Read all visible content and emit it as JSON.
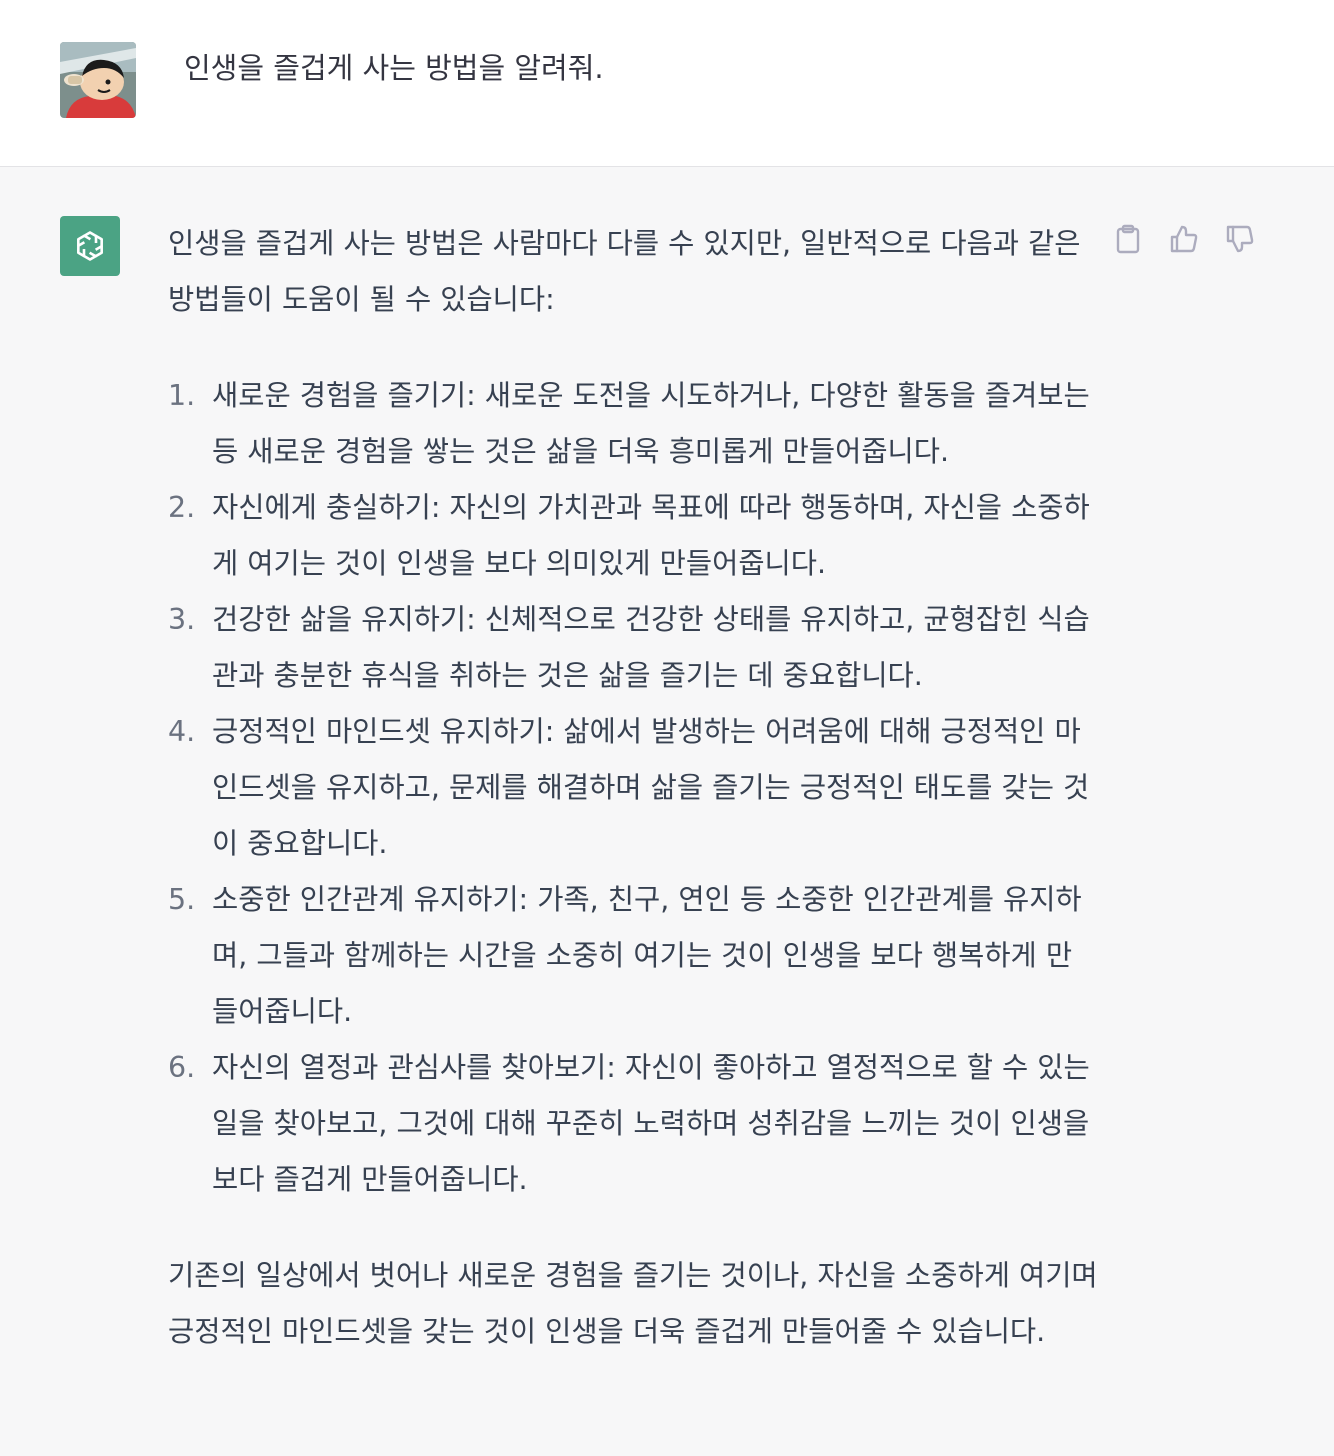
{
  "user": {
    "avatar_icon": "shin-chan-avatar-icon",
    "message": "인생을 즐겁게 사는 방법을 알려줘."
  },
  "assistant": {
    "avatar_icon": "openai-logo-icon",
    "brand_color": "#4ba384",
    "intro": "인생을 즐겁게 사는 방법은 사람마다 다를 수 있지만, 일반적으로 다음과 같은 방법들이 도움이 될 수 있습니다:",
    "items": [
      {
        "number": "1.",
        "text": "새로운 경험을 즐기기: 새로운 도전을 시도하거나, 다양한 활동을 즐겨보는 등 새로운 경험을 쌓는 것은 삶을 더욱 흥미롭게 만들어줍니다."
      },
      {
        "number": "2.",
        "text": "자신에게 충실하기: 자신의 가치관과 목표에 따라 행동하며, 자신을 소중하게 여기는 것이 인생을 보다 의미있게 만들어줍니다."
      },
      {
        "number": "3.",
        "text": "건강한 삶을 유지하기: 신체적으로 건강한 상태를 유지하고, 균형잡힌 식습관과 충분한 휴식을 취하는 것은 삶을 즐기는 데 중요합니다."
      },
      {
        "number": "4.",
        "text": "긍정적인 마인드셋 유지하기: 삶에서 발생하는 어려움에 대해 긍정적인 마인드셋을 유지하고, 문제를 해결하며 삶을 즐기는 긍정적인 태도를 갖는 것이 중요합니다."
      },
      {
        "number": "5.",
        "text": "소중한 인간관계 유지하기: 가족, 친구, 연인 등 소중한 인간관계를 유지하며, 그들과 함께하는 시간을 소중히 여기는 것이 인생을 보다 행복하게 만들어줍니다."
      },
      {
        "number": "6.",
        "text": "자신의 열정과 관심사를 찾아보기: 자신이 좋아하고 열정적으로 할 수 있는 일을 찾아보고, 그것에 대해 꾸준히 노력하며 성취감을 느끼는 것이 인생을 보다 즐겁게 만들어줍니다."
      }
    ],
    "conclusion": "기존의 일상에서 벗어나 새로운 경험을 즐기는 것이나, 자신을 소중하게 여기며 긍정적인 마인드셋을 갖는 것이 인생을 더욱 즐겁게 만들어줄 수 있습니다."
  },
  "actions": {
    "copy_icon": "clipboard-icon",
    "like_icon": "thumbs-up-icon",
    "dislike_icon": "thumbs-down-icon"
  }
}
